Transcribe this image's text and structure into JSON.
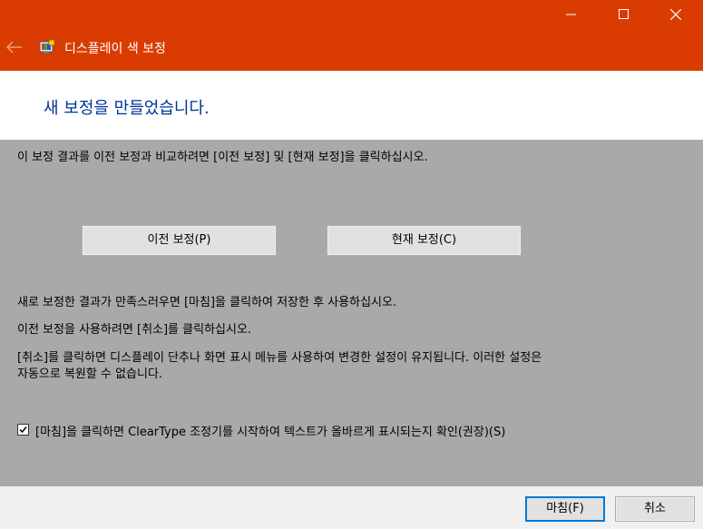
{
  "window": {
    "title": "디스플레이 색 보정",
    "accent_color": "#da3b01",
    "controls": [
      "minimize-icon",
      "maximize-icon",
      "close-icon"
    ]
  },
  "header": {
    "heading": "새 보정을 만들었습니다."
  },
  "content": {
    "compare_instruction": "이 보정 결과를 이전 보정과 비교하려면 [이전 보정] 및 [현재 보정]을 클릭하십시오.",
    "previous_button": "이전 보정(P)",
    "current_button": "현재 보정(C)",
    "satisfied_text": "새로 보정한 결과가 만족스러우면 [마침]을 클릭하여 저장한 후 사용하십시오.",
    "use_previous_text": "이전 보정을 사용하려면 [취소]를 클릭하십시오.",
    "cancel_note_line1": "[취소]를 클릭하면 디스플레이 단추나 화면 표시 메뉴를 사용하여 변경한 설정이 유지됩니다. 이러한 설정은",
    "cancel_note_line2": "자동으로 복원할 수 없습니다.",
    "cleartype_checkbox": {
      "label": "[마침]을 클릭하면 ClearType 조정기를 시작하여 텍스트가 올바르게 표시되는지 확인(권장)(S)",
      "checked": true
    }
  },
  "footer": {
    "finish_button": "마침(F)",
    "cancel_button": "취소"
  }
}
